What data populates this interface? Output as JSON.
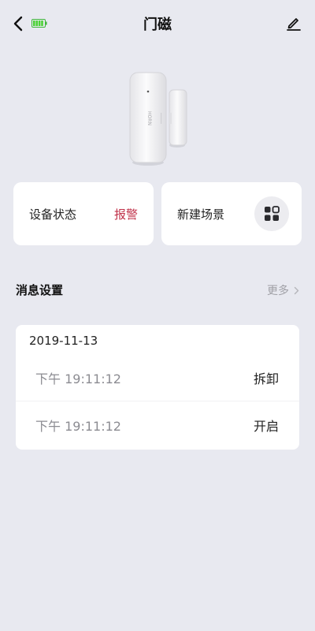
{
  "header": {
    "title": "门磁",
    "back_icon": "chevron-left-icon",
    "battery_icon": "battery-icon",
    "edit_icon": "pencil-icon",
    "battery_color": "#4cd137"
  },
  "device": {
    "brand_mark": "HORN"
  },
  "cards": {
    "status_label": "设备状态",
    "status_value": "报警",
    "status_color": "#c0324a",
    "scene_label": "新建场景",
    "scene_icon": "grid-icon"
  },
  "messages": {
    "section_title": "消息设置",
    "more_label": "更多",
    "date": "2019-11-13",
    "entries": [
      {
        "time": "下午 19:11:12",
        "event": "拆卸"
      },
      {
        "time": "下午 19:11:12",
        "event": "开启"
      }
    ]
  }
}
